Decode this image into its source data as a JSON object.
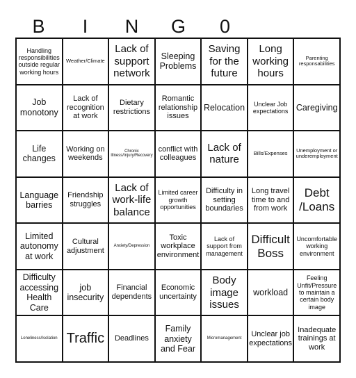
{
  "header": {
    "letters": [
      "B",
      "I",
      "N",
      "G",
      "0"
    ]
  },
  "cells": [
    {
      "text": "Handling responsibilities outside regular working hours",
      "size": "s3"
    },
    {
      "text": "Weather/Climate",
      "size": "s2"
    },
    {
      "text": "Lack of support network",
      "size": "s6"
    },
    {
      "text": "Sleeping Problems",
      "size": "s5"
    },
    {
      "text": "Saving for the future",
      "size": "s6"
    },
    {
      "text": "Long working hours",
      "size": "s6"
    },
    {
      "text": "Parenting responsabilities",
      "size": "s2"
    },
    {
      "text": "Job monotony",
      "size": "s5"
    },
    {
      "text": "Lack of recognition at work",
      "size": "s4"
    },
    {
      "text": "Dietary restrictions",
      "size": "s4"
    },
    {
      "text": "Romantic relationship issues",
      "size": "s4"
    },
    {
      "text": "Relocation",
      "size": "s5"
    },
    {
      "text": "Unclear Job expectations",
      "size": "s3"
    },
    {
      "text": "Caregiving",
      "size": "s5"
    },
    {
      "text": "Life changes",
      "size": "s5"
    },
    {
      "text": "Working on weekends",
      "size": "s4"
    },
    {
      "text": "Chronic Illness/Injury/Recovery",
      "size": "s1"
    },
    {
      "text": "conflict with colleagues",
      "size": "s4"
    },
    {
      "text": "Lack of nature",
      "size": "s6"
    },
    {
      "text": "Bills/Expenses",
      "size": "s2"
    },
    {
      "text": "Unemployment or underemployment",
      "size": "s2"
    },
    {
      "text": "Language barries",
      "size": "s5"
    },
    {
      "text": "Friendship struggles",
      "size": "s4"
    },
    {
      "text": "Lack of work-life balance",
      "size": "s6"
    },
    {
      "text": "Limited career growth opportunities",
      "size": "s3"
    },
    {
      "text": "Difficulty in setting boundaries",
      "size": "s4"
    },
    {
      "text": "Long travel time to and from work",
      "size": "s4"
    },
    {
      "text": "Debt /Loans",
      "size": "s7"
    },
    {
      "text": "Limited autonomy at work",
      "size": "s5"
    },
    {
      "text": "Cultural adjustment",
      "size": "s4"
    },
    {
      "text": "Anxiety/Depression",
      "size": "s1"
    },
    {
      "text": "Toxic workplace environment",
      "size": "s4"
    },
    {
      "text": "Lack of support from management",
      "size": "s3"
    },
    {
      "text": "Difficult Boss",
      "size": "s7"
    },
    {
      "text": "Uncomfortable working environment",
      "size": "s3"
    },
    {
      "text": "Difficulty accessing Health Care",
      "size": "s5"
    },
    {
      "text": "job insecurity",
      "size": "s5"
    },
    {
      "text": "Financial dependents",
      "size": "s4"
    },
    {
      "text": "Economic uncertainty",
      "size": "s4"
    },
    {
      "text": "Body image issues",
      "size": "s6"
    },
    {
      "text": "workload",
      "size": "s5"
    },
    {
      "text": "Feeling Unfit/Pressure to maintain a certain body image",
      "size": "s3"
    },
    {
      "text": "Loneliness/Isolation",
      "size": "s1"
    },
    {
      "text": "Traffic",
      "size": "s8"
    },
    {
      "text": "Deadlines",
      "size": "s4"
    },
    {
      "text": "Family anxiety and Fear",
      "size": "s5"
    },
    {
      "text": "Micromanagement",
      "size": "s1"
    },
    {
      "text": "Unclear job expectations",
      "size": "s4"
    },
    {
      "text": "Inadequate trainings at work",
      "size": "s4"
    }
  ]
}
